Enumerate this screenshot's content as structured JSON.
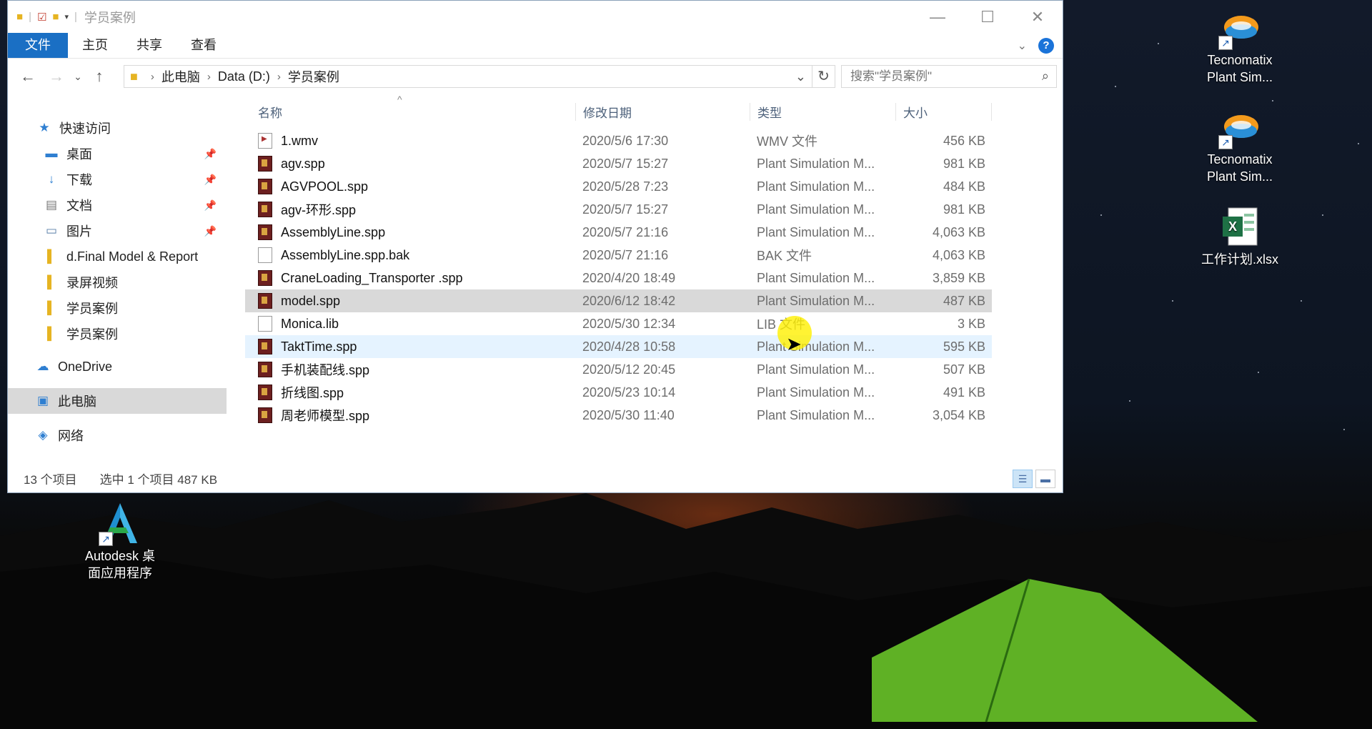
{
  "window": {
    "title": "学员案例",
    "controls": {
      "minimize": "—",
      "maximize": "☐",
      "close": "✕"
    }
  },
  "ribbon": {
    "tabs": [
      "文件",
      "主页",
      "共享",
      "查看"
    ],
    "help": "?"
  },
  "address": {
    "crumbs": [
      "此电脑",
      "Data (D:)",
      "学员案例"
    ],
    "search_placeholder": "搜索\"学员案例\""
  },
  "nav": {
    "quick_access": "快速访问",
    "items": [
      {
        "label": "桌面",
        "icon": "desktop-icon",
        "pinned": true
      },
      {
        "label": "下载",
        "icon": "download-icon",
        "pinned": true
      },
      {
        "label": "文档",
        "icon": "documents-icon",
        "pinned": true
      },
      {
        "label": "图片",
        "icon": "pictures-icon",
        "pinned": true
      },
      {
        "label": "d.Final Model & Report",
        "icon": "folder-icon",
        "pinned": false
      },
      {
        "label": "录屏视频",
        "icon": "folder-icon",
        "pinned": false
      },
      {
        "label": "学员案例",
        "icon": "folder-icon",
        "pinned": false
      },
      {
        "label": "学员案例",
        "icon": "folder-icon",
        "pinned": false
      }
    ],
    "onedrive": "OneDrive",
    "this_pc": "此电脑",
    "network": "网络"
  },
  "columns": {
    "name": "名称",
    "date": "修改日期",
    "type": "类型",
    "size": "大小"
  },
  "files": [
    {
      "name": "1.wmv",
      "date": "2020/5/6 17:30",
      "type": "WMV 文件",
      "size": "456 KB",
      "icon": "video"
    },
    {
      "name": "agv.spp",
      "date": "2020/5/7 15:27",
      "type": "Plant Simulation M...",
      "size": "981 KB",
      "icon": "spp"
    },
    {
      "name": "AGVPOOL.spp",
      "date": "2020/5/28 7:23",
      "type": "Plant Simulation M...",
      "size": "484 KB",
      "icon": "spp"
    },
    {
      "name": "agv-环形.spp",
      "date": "2020/5/7 15:27",
      "type": "Plant Simulation M...",
      "size": "981 KB",
      "icon": "spp"
    },
    {
      "name": "AssemblyLine.spp",
      "date": "2020/5/7 21:16",
      "type": "Plant Simulation M...",
      "size": "4,063 KB",
      "icon": "spp"
    },
    {
      "name": "AssemblyLine.spp.bak",
      "date": "2020/5/7 21:16",
      "type": "BAK 文件",
      "size": "4,063 KB",
      "icon": "doc"
    },
    {
      "name": "CraneLoading_Transporter .spp",
      "date": "2020/4/20 18:49",
      "type": "Plant Simulation M...",
      "size": "3,859 KB",
      "icon": "spp"
    },
    {
      "name": "model.spp",
      "date": "2020/6/12 18:42",
      "type": "Plant Simulation M...",
      "size": "487 KB",
      "icon": "spp",
      "state": "selected"
    },
    {
      "name": "Monica.lib",
      "date": "2020/5/30 12:34",
      "type": "LIB 文件",
      "size": "3 KB",
      "icon": "doc"
    },
    {
      "name": "TaktTime.spp",
      "date": "2020/4/28 10:58",
      "type": "Plant Simulation M...",
      "size": "595 KB",
      "icon": "spp",
      "state": "hover"
    },
    {
      "name": "手机装配线.spp",
      "date": "2020/5/12 20:45",
      "type": "Plant Simulation M...",
      "size": "507 KB",
      "icon": "spp"
    },
    {
      "name": "折线图.spp",
      "date": "2020/5/23 10:14",
      "type": "Plant Simulation M...",
      "size": "491 KB",
      "icon": "spp"
    },
    {
      "name": "周老师模型.spp",
      "date": "2020/5/30 11:40",
      "type": "Plant Simulation M...",
      "size": "3,054 KB",
      "icon": "spp"
    }
  ],
  "status": {
    "count": "13 个项目",
    "selection": "选中 1 个项目  487 KB"
  },
  "desktop": [
    {
      "label": "Tecnomatix Plant Sim...",
      "icon": "tecnomatix-icon"
    },
    {
      "label": "Tecnomatix Plant Sim...",
      "icon": "tecnomatix-icon"
    },
    {
      "label": "工作计划.xlsx",
      "icon": "excel-icon"
    },
    {
      "label": "Autodesk 桌面应用程序",
      "icon": "autodesk-icon"
    }
  ]
}
